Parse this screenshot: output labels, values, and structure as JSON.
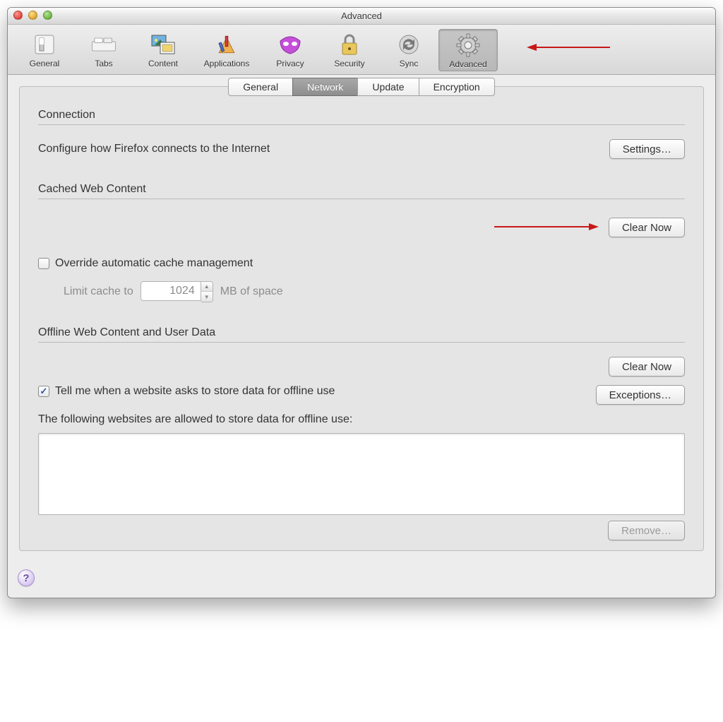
{
  "window": {
    "title": "Advanced"
  },
  "toolbar": {
    "items": [
      {
        "label": "General"
      },
      {
        "label": "Tabs"
      },
      {
        "label": "Content"
      },
      {
        "label": "Applications"
      },
      {
        "label": "Privacy"
      },
      {
        "label": "Security"
      },
      {
        "label": "Sync"
      },
      {
        "label": "Advanced"
      }
    ],
    "active_index": 7
  },
  "tabs": {
    "items": [
      "General",
      "Network",
      "Update",
      "Encryption"
    ],
    "active_index": 1
  },
  "connection": {
    "heading": "Connection",
    "desc": "Configure how Firefox connects to the Internet",
    "settings_btn": "Settings…"
  },
  "cache": {
    "heading": "Cached Web Content",
    "clear_btn": "Clear Now",
    "override_label": "Override automatic cache management",
    "override_checked": false,
    "limit_prefix": "Limit cache to",
    "limit_value": "1024",
    "limit_suffix": "MB of space"
  },
  "offline": {
    "heading": "Offline Web Content and User Data",
    "clear_btn": "Clear Now",
    "exceptions_btn": "Exceptions…",
    "tell_label": "Tell me when a website asks to store data for offline use",
    "tell_checked": true,
    "list_label": "The following websites are allowed to store data for offline use:",
    "remove_btn": "Remove…"
  },
  "help_glyph": "?"
}
